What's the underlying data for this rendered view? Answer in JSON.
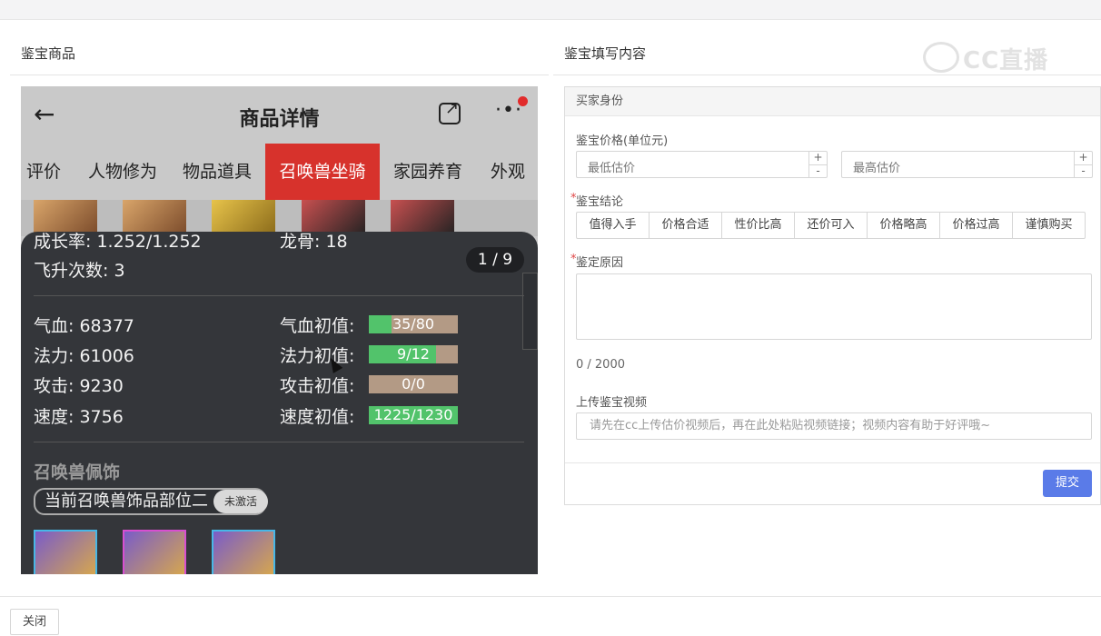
{
  "left": {
    "title": "鉴宝商品"
  },
  "right": {
    "title": "鉴宝填写内容"
  },
  "watermark": {
    "text": "CC直播"
  },
  "phone": {
    "back_icon": "arrow-left-icon",
    "title": "商品详情",
    "share_icon": "external-share-icon",
    "more_icon": "more-dots-icon",
    "tabs": [
      "评价",
      "人物修为",
      "物品道具",
      "召唤兽坐骑",
      "家园养育",
      "外观"
    ],
    "active_tab": "召唤兽坐骑",
    "growth": "成长率: 1.252/1.252",
    "dragon_bone": "龙骨: 18",
    "ascend": "飞升次数: 3",
    "pager": "1 / 9",
    "stats": [
      {
        "label": "气血: 68377",
        "init_label": "气血初值:",
        "init_value": "35/80",
        "fill": 0.25
      },
      {
        "label": "法力: 61006",
        "init_label": "法力初值:",
        "init_value": "9/12",
        "fill": 0.75
      },
      {
        "label": "攻击: 9230",
        "init_label": "攻击初值:",
        "init_value": "0/0",
        "fill": 0
      },
      {
        "label": "速度: 3756",
        "init_label": "速度初值:",
        "init_value": "1225/1230",
        "fill": 1
      }
    ],
    "accessory_heading": "召唤兽佩饰",
    "accessory_slot": "当前召唤兽饰品部位二",
    "accessory_badge": "未激活"
  },
  "form": {
    "header": "买家身份",
    "price_label": "鉴宝价格(单位元)",
    "min_placeholder": "最低估价",
    "max_placeholder": "最高估价",
    "conclusion_label": "鉴宝结论",
    "conclusions": [
      "值得入手",
      "价格合适",
      "性价比高",
      "还价可入",
      "价格略高",
      "价格过高",
      "谨慎购买"
    ],
    "reason_label": "鉴定原因",
    "counter": "0 / 2000",
    "video_label": "上传鉴宝视频",
    "video_placeholder": "请先在cc上传估价视频后，再在此处粘贴视频链接；视频内容有助于好评哦~",
    "submit": "提交"
  },
  "footer": {
    "close": "关闭"
  }
}
